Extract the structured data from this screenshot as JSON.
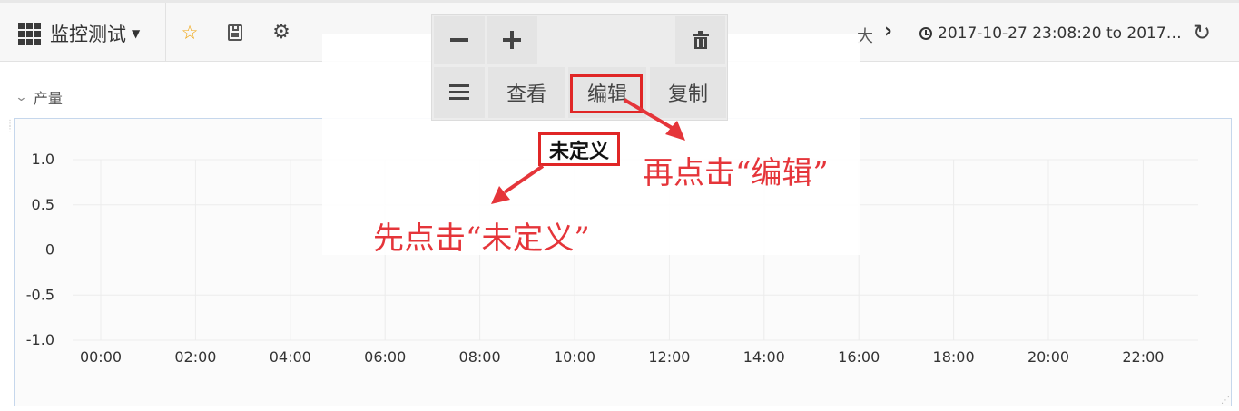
{
  "topbar": {
    "dashboard_title": "监控测试",
    "zoom_text": "大",
    "time_range": "2017-10-27 23:08:20 to 2017…"
  },
  "row": {
    "title": "产量"
  },
  "panel_menu": {
    "labels": [
      "查看",
      "编辑",
      "复制"
    ],
    "icons": [
      "minus-icon",
      "plus-icon",
      "trash-icon",
      "hamburger-icon"
    ]
  },
  "panel": {
    "title": "未定义"
  },
  "annotations": {
    "first": "先点击“未定义”",
    "second": "再点击“编辑”"
  },
  "chart_data": {
    "type": "line",
    "title": "未定义",
    "x_ticks": [
      "00:00",
      "02:00",
      "04:00",
      "06:00",
      "08:00",
      "10:00",
      "12:00",
      "14:00",
      "16:00",
      "18:00",
      "20:00",
      "22:00"
    ],
    "y_ticks": [
      "1.0",
      "0.5",
      "0",
      "-0.5",
      "-1.0"
    ],
    "ylim": [
      -1.0,
      1.0
    ],
    "grid": true,
    "series": []
  },
  "colors": {
    "accent": "#f0a30a",
    "annotation": "#e5353a",
    "panel_border": "#c6d7ec"
  }
}
